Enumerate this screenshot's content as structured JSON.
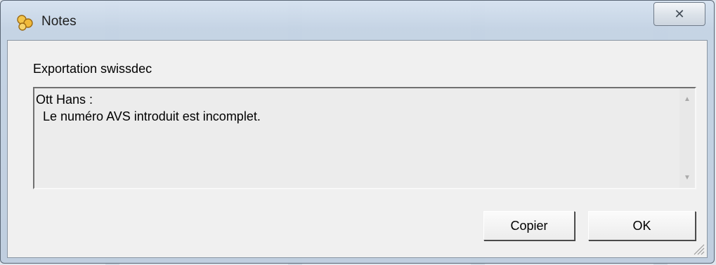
{
  "window": {
    "title": "Notes",
    "close_glyph": "✕"
  },
  "dialog": {
    "heading": "Exportation swissdec",
    "message_lines": [
      "Ott Hans :",
      "  Le numéro AVS introduit est incomplet."
    ],
    "buttons": {
      "copy_label": "Copier",
      "ok_label": "OK"
    }
  },
  "icons": {
    "app": "notes-bubbles-icon",
    "close": "close-icon",
    "scroll_up": "scroll-up-arrow-icon",
    "scroll_down": "scroll-down-arrow-icon",
    "resize": "resize-grip-icon"
  },
  "colors": {
    "frame": "#c4d3e4",
    "client_background": "#f0f0f0",
    "textarea_background": "#ececec"
  }
}
